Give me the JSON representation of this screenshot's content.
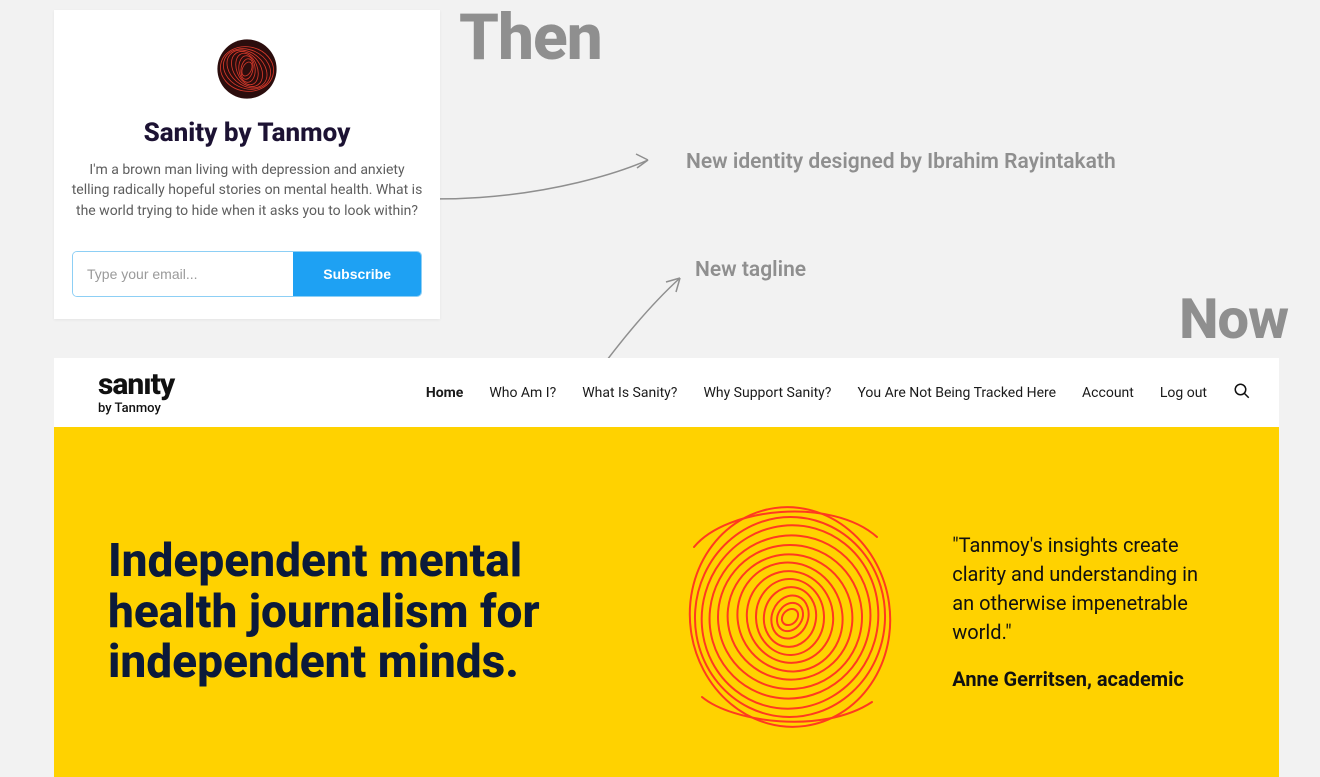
{
  "labels": {
    "then": "Then",
    "now": "Now"
  },
  "annotations": {
    "identity": "New identity designed by Ibrahim Rayintakath",
    "tagline": "New tagline"
  },
  "old": {
    "title": "Sanity by Tanmoy",
    "description": "I'm a brown man living with depression and anxiety telling radically hopeful stories on mental health. What is the world trying to hide when it asks you to look within?",
    "email_placeholder": "Type your email...",
    "subscribe_label": "Subscribe"
  },
  "new_site": {
    "brand": "sanıty",
    "byline": "by Tanmoy",
    "nav": [
      {
        "label": "Home",
        "active": true
      },
      {
        "label": "Who Am I?",
        "active": false
      },
      {
        "label": "What Is Sanity?",
        "active": false
      },
      {
        "label": "Why Support Sanity?",
        "active": false
      },
      {
        "label": "You Are Not Being Tracked Here",
        "active": false
      },
      {
        "label": "Account",
        "active": false
      },
      {
        "label": "Log out",
        "active": false
      }
    ],
    "tagline": "Independent mental health journalism for independent minds.",
    "quote": "\"Tanmoy's insights create clarity and understanding in an otherwise impenetrable world.\"",
    "attribution": "Anne Gerritsen, academic",
    "colors": {
      "hero_bg": "#ffd200",
      "brand_ink": "#0b1a3a",
      "swirl": "#ff3a1f"
    }
  }
}
